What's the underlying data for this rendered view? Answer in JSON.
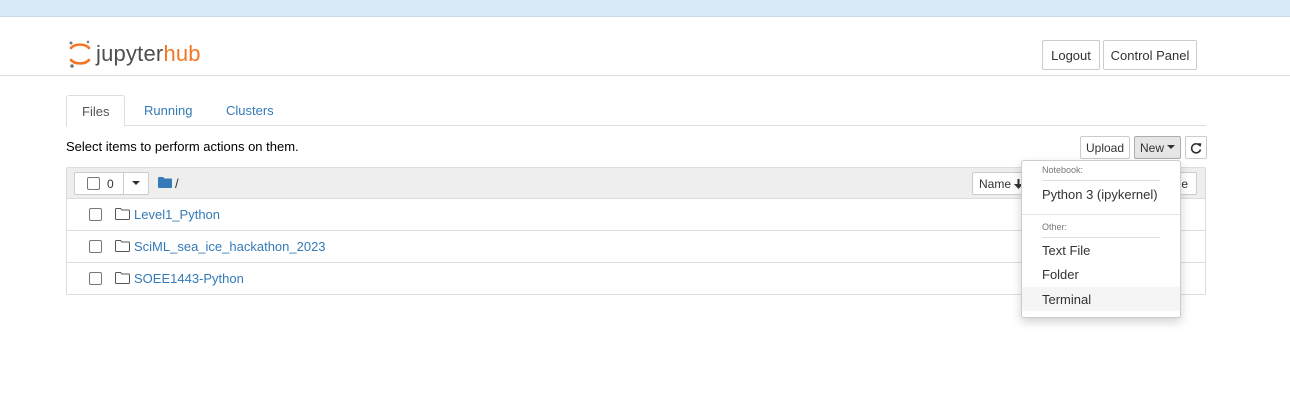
{
  "brand": {
    "part1": "jupyter",
    "part2": "hub"
  },
  "header": {
    "logout_label": "Logout",
    "control_panel_label": "Control Panel"
  },
  "tabs": [
    {
      "label": "Files",
      "active": true
    },
    {
      "label": "Running",
      "active": false
    },
    {
      "label": "Clusters",
      "active": false
    }
  ],
  "toolbar": {
    "hint": "Select items to perform actions on them.",
    "upload_label": "Upload",
    "new_label": "New",
    "selected_count": "0",
    "breadcrumb": "/",
    "sort_label": "Name",
    "hidden_col_fragment": "ze"
  },
  "files": [
    {
      "name": "Level1_Python",
      "type": "folder"
    },
    {
      "name": "SciML_sea_ice_hackathon_2023",
      "type": "folder"
    },
    {
      "name": "SOEE1443-Python",
      "type": "folder"
    }
  ],
  "new_menu": {
    "notebook_header": "Notebook:",
    "notebook_items": [
      "Python 3 (ipykernel)"
    ],
    "other_header": "Other:",
    "other_items": [
      "Text File",
      "Folder",
      "Terminal"
    ],
    "highlighted": "Terminal"
  },
  "colors": {
    "accent": "#f37726",
    "link": "#337ab7",
    "topbar": "#d9eaf7"
  }
}
